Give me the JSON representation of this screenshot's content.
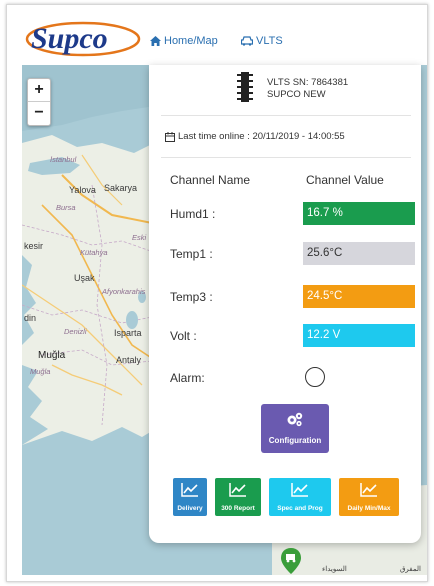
{
  "header": {
    "brand": "Supco",
    "nav": [
      {
        "label": "Home/Map",
        "icon": "home-icon"
      },
      {
        "label": "VLTS",
        "icon": "car-icon"
      }
    ]
  },
  "map": {
    "zoom_in": "+",
    "zoom_out": "−",
    "labels": {
      "istanbul": "İstanbul",
      "yalova": "Yalova",
      "sakarya": "Sakarya",
      "bursa": "Bursa",
      "eski": "Eski",
      "kesir": "kesir",
      "kutahya": "Kütahya",
      "usak": "Uşak",
      "afyon": "Afyonkarahis",
      "din": "din",
      "denizli": "Denizli",
      "isparta": "Isparta",
      "mugla": "Muğla",
      "antalya": "Antaly",
      "mugla_small": "Muğla",
      "arabic1": "السويداء",
      "arabic2": "المفرق"
    }
  },
  "device": {
    "sn_line": "VLTS SN: 7864381",
    "name_line": "SUPCO NEW",
    "last_online": "Last time online : 20/11/2019 - 14:00:55"
  },
  "table": {
    "col_name": "Channel Name",
    "col_value": "Channel Value",
    "rows": [
      {
        "name": "Humd1 :",
        "value": "16.7 %",
        "color": "#1a9c4e"
      },
      {
        "name": "Temp1 :",
        "value": "25.6°C",
        "color": "#d6d6dc"
      },
      {
        "name": "Temp3 :",
        "value": "24.5°C",
        "color": "#f39c12"
      },
      {
        "name": "Volt :",
        "value": "12.2 V",
        "color": "#1ec9ee"
      }
    ],
    "alarm_label": "Alarm:"
  },
  "configuration": {
    "label": "Configuration",
    "color": "#6a5ab0",
    "icon": "gears-icon"
  },
  "actions": [
    {
      "label": "Delivery",
      "color": "#2f86c6",
      "icon": "line-chart-icon"
    },
    {
      "label": "300 Report",
      "color": "#1a9c4e",
      "icon": "line-chart-icon"
    },
    {
      "label": "Spec and Prog",
      "color": "#1ec9ee",
      "icon": "line-chart-icon"
    },
    {
      "label": "Daily Min/Max",
      "color": "#f39c12",
      "icon": "line-chart-icon"
    }
  ]
}
